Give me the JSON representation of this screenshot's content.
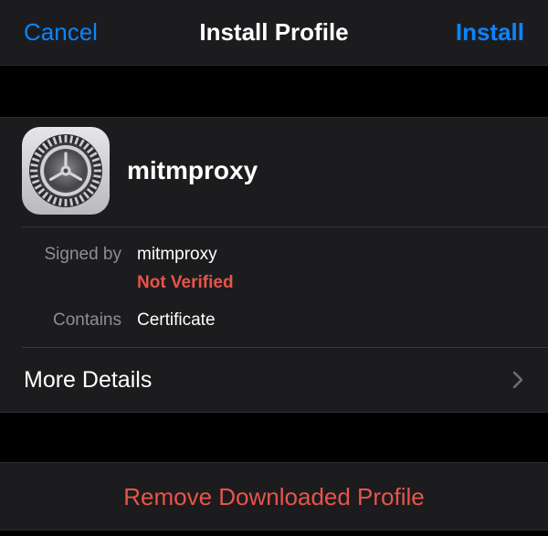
{
  "navbar": {
    "cancel_label": "Cancel",
    "title": "Install Profile",
    "install_label": "Install"
  },
  "profile": {
    "icon": "settings-gear-icon",
    "name": "mitmproxy",
    "signed_by_label": "Signed by",
    "signed_by_value": "mitmproxy",
    "verification_status": "Not Verified",
    "contains_label": "Contains",
    "contains_value": "Certificate"
  },
  "more_details": {
    "label": "More Details",
    "icon": "chevron-right-icon"
  },
  "remove": {
    "label": "Remove Downloaded Profile"
  },
  "colors": {
    "accent": "#0a84ff",
    "destructive": "#e8544a",
    "background": "#000000",
    "cell_background": "#1c1c1e",
    "secondary_text": "#8e8e93"
  }
}
